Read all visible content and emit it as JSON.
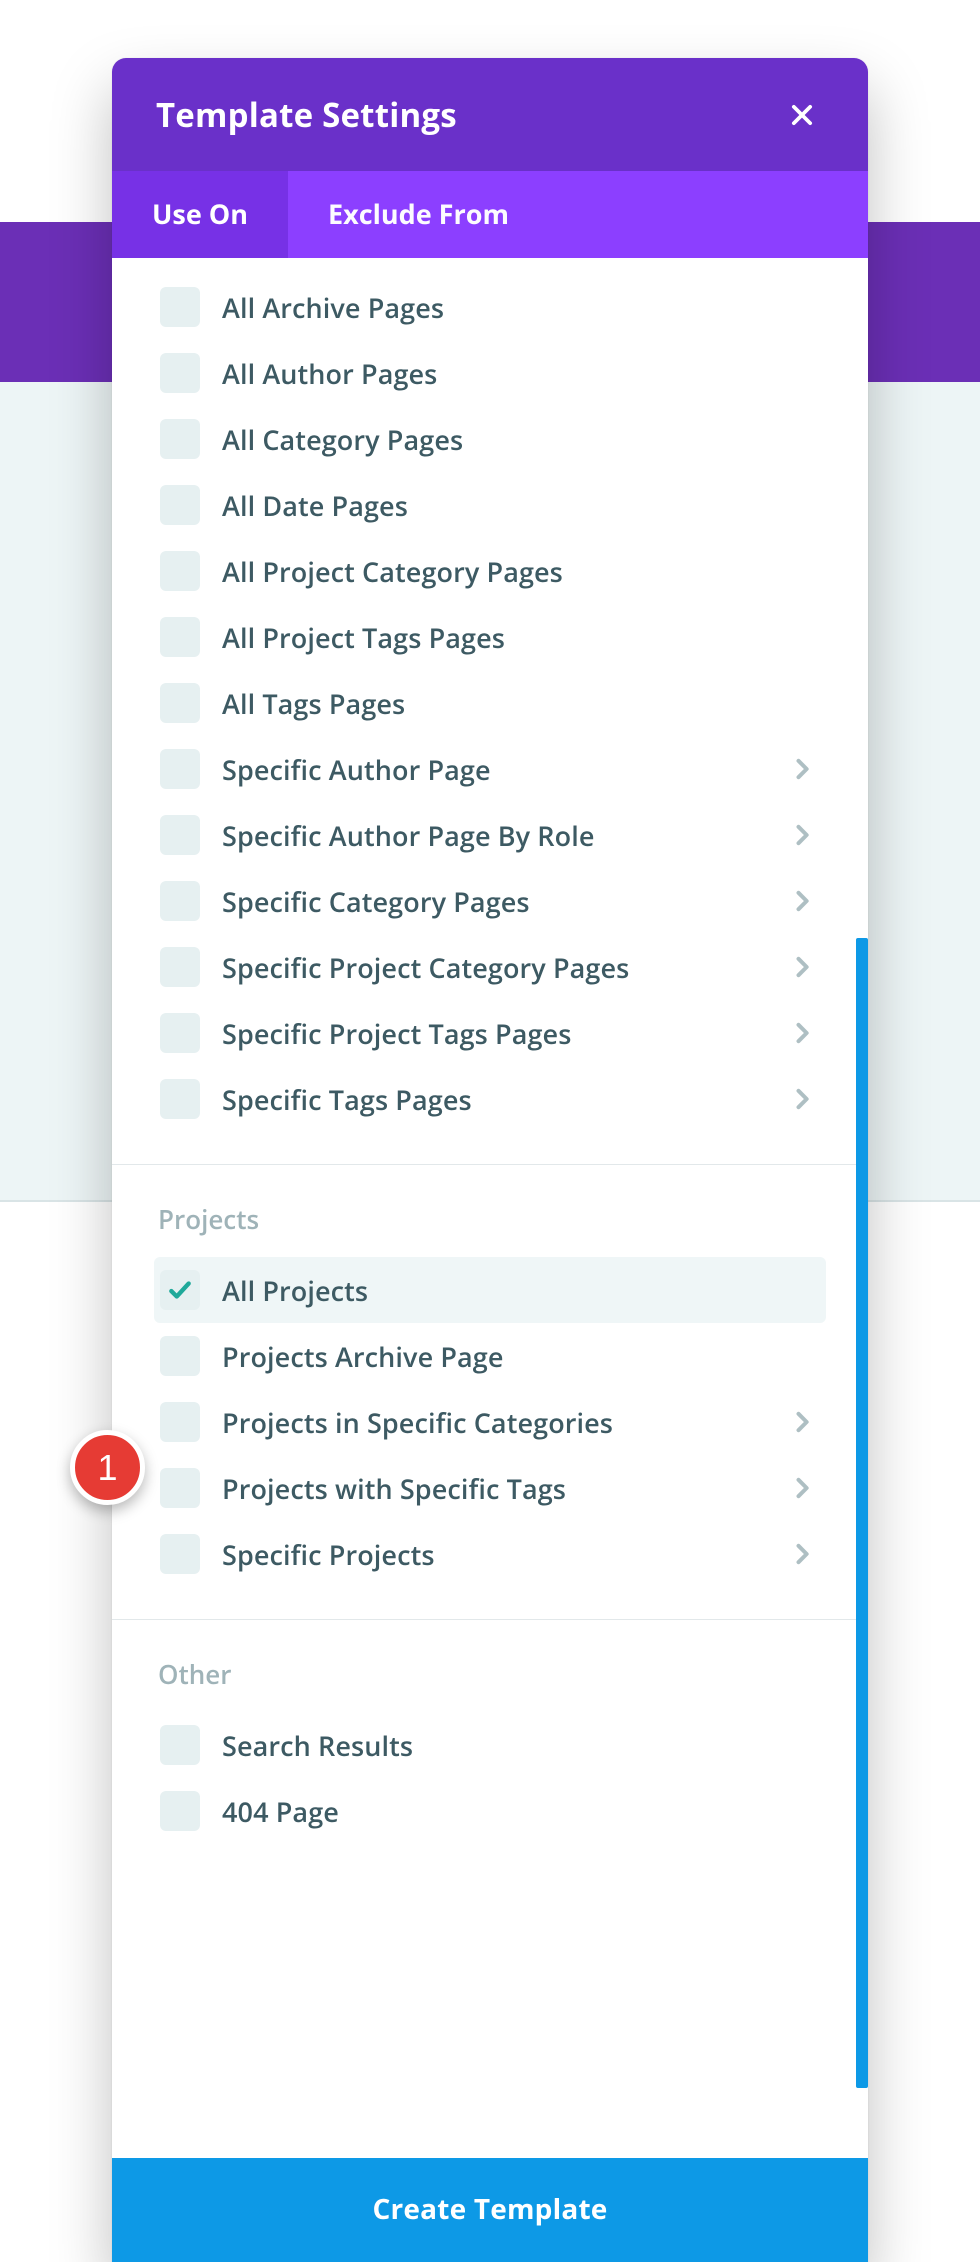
{
  "header": {
    "title": "Template Settings"
  },
  "tabs": {
    "use_on": "Use On",
    "exclude_from": "Exclude From"
  },
  "sections": {
    "archive": {
      "items": [
        {
          "label": "All Archive Pages",
          "chev": false
        },
        {
          "label": "All Author Pages",
          "chev": false
        },
        {
          "label": "All Category Pages",
          "chev": false
        },
        {
          "label": "All Date Pages",
          "chev": false
        },
        {
          "label": "All Project Category Pages",
          "chev": false
        },
        {
          "label": "All Project Tags Pages",
          "chev": false
        },
        {
          "label": "All Tags Pages",
          "chev": false
        },
        {
          "label": "Specific Author Page",
          "chev": true
        },
        {
          "label": "Specific Author Page By Role",
          "chev": true
        },
        {
          "label": "Specific Category Pages",
          "chev": true
        },
        {
          "label": "Specific Project Category Pages",
          "chev": true
        },
        {
          "label": "Specific Project Tags Pages",
          "chev": true
        },
        {
          "label": "Specific Tags Pages",
          "chev": true
        }
      ]
    },
    "projects": {
      "title": "Projects",
      "items": [
        {
          "label": "All Projects",
          "chev": false,
          "checked": true
        },
        {
          "label": "Projects Archive Page",
          "chev": false
        },
        {
          "label": "Projects in Specific Categories",
          "chev": true
        },
        {
          "label": "Projects with Specific Tags",
          "chev": true
        },
        {
          "label": "Specific Projects",
          "chev": true
        }
      ]
    },
    "other": {
      "title": "Other",
      "items": [
        {
          "label": "Search Results",
          "chev": false
        },
        {
          "label": "404 Page",
          "chev": false
        }
      ]
    }
  },
  "footer": {
    "create": "Create Template"
  },
  "annotations": {
    "badge1": "1"
  }
}
